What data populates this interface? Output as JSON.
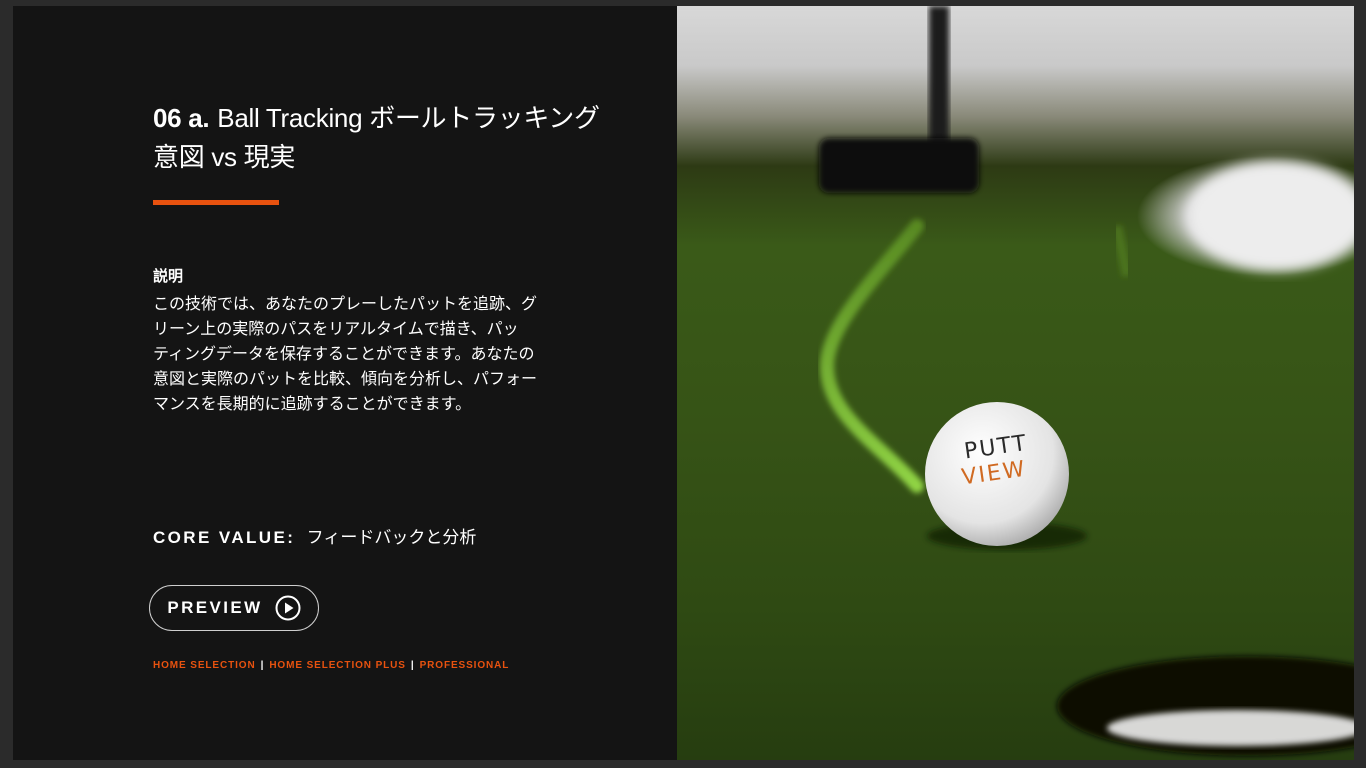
{
  "slide": {
    "title_number": "06 a.",
    "title_text": "Ball Tracking ボールトラッキング",
    "title_line2": "意図 vs 現実",
    "accent_color": "#e8520f"
  },
  "description": {
    "heading": "説明",
    "lines": [
      "この技術では、あなたのプレーしたパットを追跡、グ",
      "リーン上の実際のパスをリアルタイムで描き、パッ",
      "ティングデータを保存することができます。あなたの",
      "意図と実際のパットを比較、傾向を分析し、パフォー",
      "マンスを長期的に追跡することができます。"
    ]
  },
  "core_value": {
    "label": "CORE VALUE:",
    "value": "フィードバックと分析"
  },
  "preview_button": {
    "label": "PREVIEW",
    "icon": "play-circle-icon"
  },
  "editions": [
    "HOME SELECTION",
    "HOME SELECTION PLUS",
    "PROFESSIONAL"
  ],
  "editions_separator": "|",
  "photo": {
    "ball_text_line1": "PUTT",
    "ball_text_line2": "VIEW"
  }
}
